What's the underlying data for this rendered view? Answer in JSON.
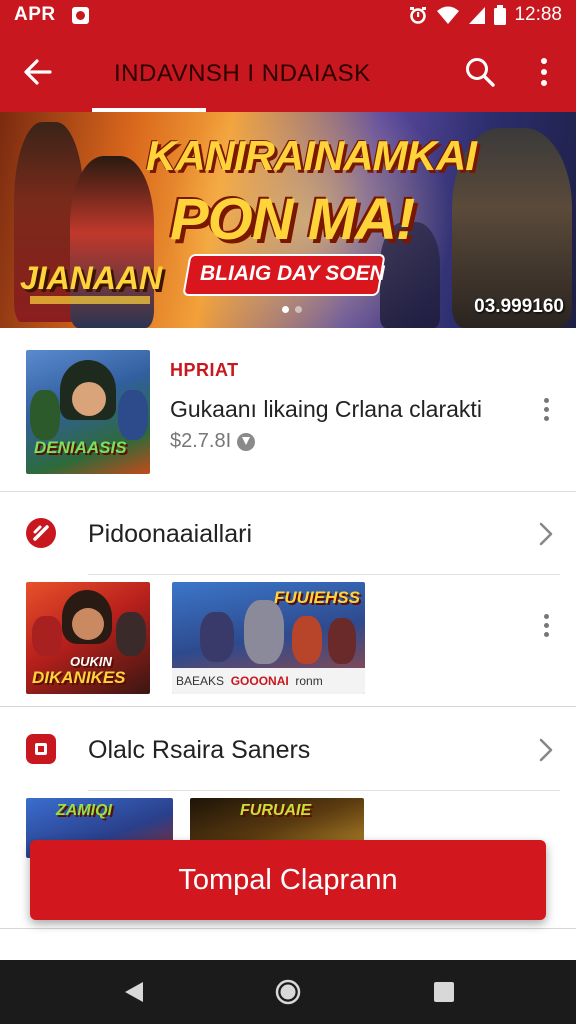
{
  "status_bar": {
    "left_text": "APR",
    "time": "12:88"
  },
  "toolbar": {
    "title": "INDAVNSH I NDAIASK"
  },
  "hero": {
    "headline_line1": "KANIRAINAMKAI",
    "headline_line2": "PON MA!",
    "pill_text": "BLIAIG DAY SOEN",
    "logo_text": "JIANAAN",
    "counter": "03.999160"
  },
  "featured": {
    "tag": "HPRIAT",
    "name": "Gukaanı likaing Crlana clarakti",
    "price": "$2.7.8I",
    "thumb_title": "DENIAASIS"
  },
  "section1": {
    "label": "Pidoonaaiallari",
    "item1_title": "DIKANIKES",
    "item1_title_top": "OUKIN",
    "item2_title": "FUUIEHSS",
    "item2_strip_a": "BAEAKS",
    "item2_strip_b": "GOOONAI",
    "item2_strip_c": "ronm"
  },
  "section2": {
    "label": "Olalc Rsaira Saners",
    "item1_title": "ZAMIQI",
    "item2_title": "FURUAIE"
  },
  "cta": {
    "label": "Tompal Claprann"
  },
  "colors": {
    "brand_red": "#c8171e",
    "cta_red": "#d2171f",
    "accent_yellow": "#ffd43a",
    "nav_bar": "#1b1b1b"
  },
  "icons": {
    "back": "arrow-left-icon",
    "search": "search-icon",
    "overflow": "more-vert-icon",
    "section1": "red-circle-icon",
    "section2": "red-rounded-square-icon",
    "nav_back": "triangle-back-icon",
    "nav_home": "circle-home-icon",
    "nav_recents": "square-recents-icon"
  }
}
